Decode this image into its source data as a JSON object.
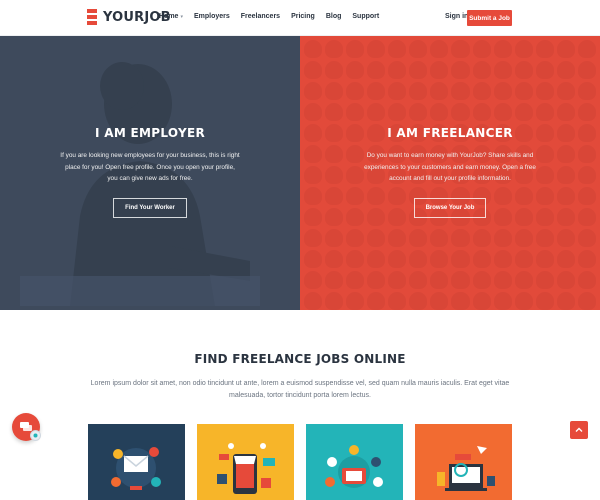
{
  "header": {
    "logo_text": "YOURJOB",
    "nav": [
      {
        "label": "Home",
        "has_dropdown": true
      },
      {
        "label": "Employers"
      },
      {
        "label": "Freelancers"
      },
      {
        "label": "Pricing"
      },
      {
        "label": "Blog"
      },
      {
        "label": "Support"
      }
    ],
    "signin_label": "Sign in",
    "submit_label": "Submit a Job"
  },
  "hero": {
    "employer": {
      "title": "I AM EMPLOYER",
      "text": "If you are looking new employees for your business, this is right place for you! Open free profile. Once you open your profile, you can give new ads for free.",
      "button": "Find Your Worker"
    },
    "freelancer": {
      "title": "I AM FREELANCER",
      "text": "Do you want to earn money with YourJob? Share skills and experiences to your customers and earn money. Open a free account and fill out your profile information.",
      "button": "Browse Your Job"
    }
  },
  "section": {
    "title": "FIND FREELANCE JOBS ONLINE",
    "text": "Lorem ipsum dolor sit amet, non odio tincidunt ut ante, lorem a euismod suspendisse vel, sed quam nulla mauris iaculis. Erat eget vitae malesuada, tortor tincidunt porta lorem lectus."
  },
  "cards": [
    {
      "icon": "email-marketing-icon",
      "color": "#24405a"
    },
    {
      "icon": "online-shop-icon",
      "color": "#f7b529"
    },
    {
      "icon": "social-network-icon",
      "color": "#23b4b8"
    },
    {
      "icon": "web-design-icon",
      "color": "#f26b31"
    }
  ],
  "colors": {
    "accent": "#e64a3a",
    "employer_bg": "#3e4a5c",
    "freelancer_bg": "#e24a3a"
  }
}
